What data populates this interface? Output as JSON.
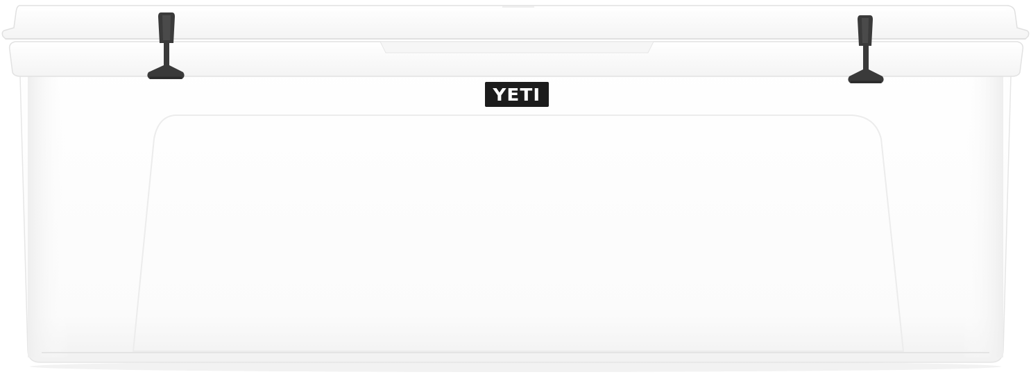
{
  "product": {
    "brand_logo_text": "YETI",
    "color": "#ffffff",
    "latch_color": "#3a3a3a",
    "logo_badge_color": "#1c1c1c"
  }
}
